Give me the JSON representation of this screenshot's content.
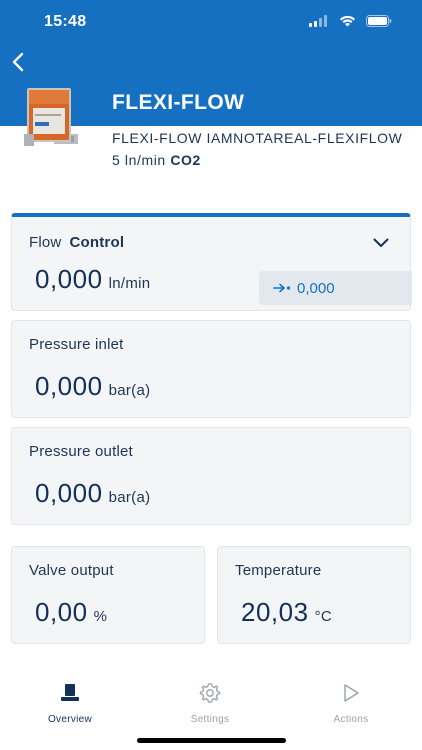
{
  "status_bar": {
    "time": "15:48"
  },
  "device": {
    "title": "FLEXI-FLOW",
    "subtitle": "FLEXI-FLOW  IAMNOTAREAL-FLEXIFLOW",
    "range": "5 ln/min",
    "gas": "CO2",
    "image_label": "FLEXI-FLOW"
  },
  "flow": {
    "label": "Flow",
    "mode": "Control",
    "value": "0,000",
    "unit": "ln/min",
    "setpoint": "0,000"
  },
  "pressure_inlet": {
    "label": "Pressure inlet",
    "value": "0,000",
    "unit": "bar(a)"
  },
  "pressure_outlet": {
    "label": "Pressure outlet",
    "value": "0,000",
    "unit": "bar(a)"
  },
  "valve_output": {
    "label": "Valve output",
    "value": "0,00",
    "unit": "%"
  },
  "temperature": {
    "label": "Temperature",
    "value": "20,03",
    "unit": "°C"
  },
  "tabs": [
    {
      "label": "Overview",
      "icon": "device-icon",
      "active": true
    },
    {
      "label": "Settings",
      "icon": "gear-icon",
      "active": false
    },
    {
      "label": "Actions",
      "icon": "play-icon",
      "active": false
    }
  ],
  "colors": {
    "brand_blue": "#1670c2",
    "card_bg": "#f4f5f7",
    "text_dark": "#14305a",
    "inactive": "#9aa1ab"
  }
}
